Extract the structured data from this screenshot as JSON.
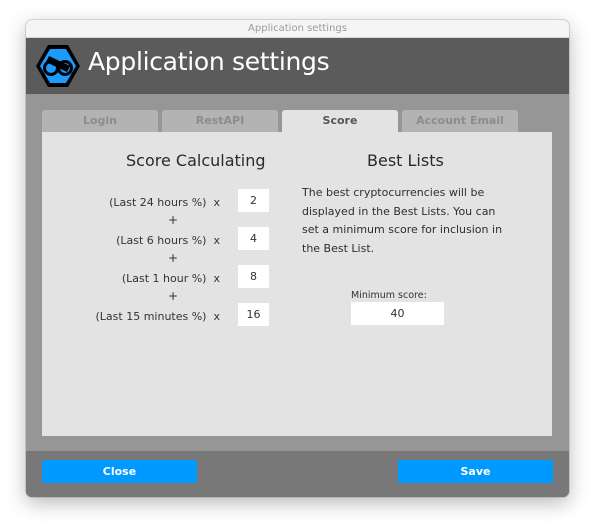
{
  "window": {
    "title": "Application settings"
  },
  "header": {
    "title": "Application settings",
    "logo_icon": "infinity-hexagon-logo-icon"
  },
  "tabs": [
    {
      "label": "Login",
      "active": false
    },
    {
      "label": "RestAPI",
      "active": false
    },
    {
      "label": "Score",
      "active": true
    },
    {
      "label": "Account Email",
      "active": false
    }
  ],
  "score": {
    "title": "Score Calculating",
    "multiply_sign": "x",
    "plus_sign": "+",
    "rows": [
      {
        "label": "(Last 24 hours %)",
        "value": "2"
      },
      {
        "label": "(Last 6 hours %)",
        "value": "4"
      },
      {
        "label": "(Last 1 hour %)",
        "value": "8"
      },
      {
        "label": "(Last 15 minutes %)",
        "value": "16"
      }
    ]
  },
  "best_lists": {
    "title": "Best Lists",
    "description": "The best cryptocurrencies will be displayed in the Best Lists. You can set a minimum score for inclusion in the Best List.",
    "min_score_label": "Minimum score:",
    "min_score_value": "40"
  },
  "footer": {
    "close_label": "Close",
    "save_label": "Save"
  },
  "colors": {
    "accent": "#0099ff",
    "header_bg": "#5b5b5b",
    "panel_bg": "#e3e3e3",
    "footer_bg": "#787878"
  }
}
